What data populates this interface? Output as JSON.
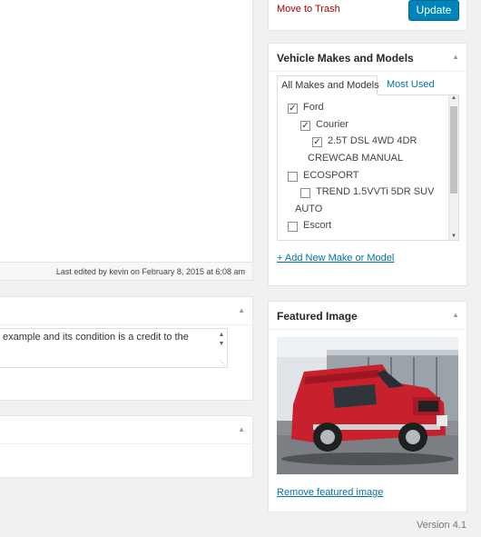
{
  "editor": {
    "last_edited": "Last edited by kevin on February 8, 2015 at 6:08 am"
  },
  "excerpt": {
    "text": "example and its condition is a credit to the"
  },
  "publish": {
    "trash_label": "Move to Trash",
    "update_label": "Update"
  },
  "makes": {
    "title": "Vehicle Makes and Models",
    "tab_all": "All Makes and Models",
    "tab_used": "Most Used",
    "terms": [
      {
        "label": "Ford",
        "checked": true
      },
      {
        "label": "Courier",
        "checked": true
      },
      {
        "label": "2.5T DSL 4WD 4DR",
        "checked": true
      },
      {
        "label": "CREWCAB MANUAL",
        "checked": null
      },
      {
        "label": "ECOSPORT",
        "checked": false
      },
      {
        "label": "TREND 1.5VVTi 5DR SUV",
        "checked": false
      },
      {
        "label": "AUTO",
        "checked": null
      },
      {
        "label": "Escort",
        "checked": false
      }
    ],
    "add_new": "+ Add New Make or Model"
  },
  "featured": {
    "title": "Featured Image",
    "remove_label": "Remove featured image",
    "image_subject": "red pickup truck"
  },
  "footer": {
    "version": "Version 4.1"
  },
  "colors": {
    "accent": "#0085ba",
    "link": "#0073aa",
    "trash": "#a00000"
  }
}
